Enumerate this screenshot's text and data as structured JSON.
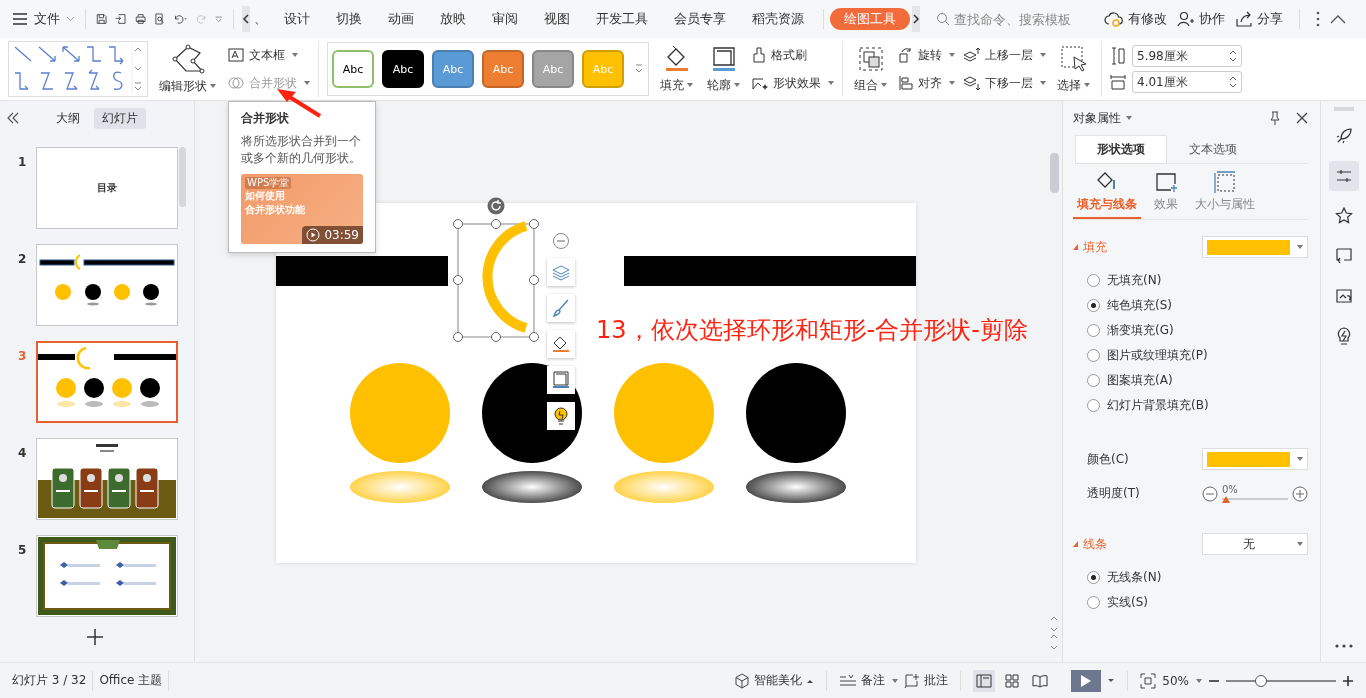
{
  "menu": {
    "file": "文件",
    "partial_tab": "、",
    "tabs": [
      {
        "label": "设计",
        "selected": false
      },
      {
        "label": "切换",
        "selected": false
      },
      {
        "label": "动画",
        "selected": false
      },
      {
        "label": "放映",
        "selected": false
      },
      {
        "label": "审阅",
        "selected": false
      },
      {
        "label": "视图",
        "selected": false
      },
      {
        "label": "开发工具",
        "selected": false
      },
      {
        "label": "会员专享",
        "selected": false
      },
      {
        "label": "稻壳资源",
        "selected": false
      }
    ],
    "context_tab": {
      "label": "绘图工具",
      "selected": true
    },
    "search": {
      "placeholder": "查找命令、搜索模板"
    },
    "actions": [
      "有修改",
      "协作",
      "分享"
    ]
  },
  "ribbon": {
    "edit_shape": "编辑形状",
    "textbox": "文本框",
    "merge_shape": {
      "label": "合并形状",
      "disabled": true
    },
    "styles": [
      {
        "label": "Abc",
        "color": "#ffffff"
      },
      {
        "label": "Abc",
        "color": "#000000"
      },
      {
        "label": "Abc",
        "color": "#5b9bd5"
      },
      {
        "label": "Abc",
        "color": "#ed7d31"
      },
      {
        "label": "Abc",
        "color": "#a5a5a5"
      },
      {
        "label": "Abc",
        "color": "#ffc000"
      }
    ],
    "fill": "填充",
    "outline": "轮廓",
    "format_painter": "格式刷",
    "shape_effects": "形状效果",
    "group": "组合",
    "rotate": "旋转",
    "align": "对齐",
    "bring_forward": "上移一层",
    "send_backward": "下移一层",
    "select": "选择",
    "height": "5.98厘米",
    "width": "4.01厘米"
  },
  "tooltip": {
    "title": "合并形状",
    "description": "将所选形状合并到一个或多个新的几何形状。",
    "video": {
      "brand": "WPS学堂",
      "title": [
        "如何使用",
        "合并形状功能"
      ],
      "duration": "03:59"
    }
  },
  "slides_panel": {
    "tabs": [
      {
        "label": "大纲",
        "selected": false
      },
      {
        "label": "幻灯片",
        "selected": true
      }
    ],
    "slides": [
      {
        "number": "1",
        "kind": "toc",
        "text": "目录",
        "selected": false
      },
      {
        "number": "2",
        "kind": "bars",
        "selected": false
      },
      {
        "number": "3",
        "kind": "current",
        "selected": true
      },
      {
        "number": "4",
        "kind": "cards",
        "selected": false
      },
      {
        "number": "5",
        "kind": "frame",
        "selected": false
      }
    ]
  },
  "slide": {
    "circles": [
      {
        "color": "#ffc000"
      },
      {
        "color": "#000000"
      },
      {
        "color": "#ffc000"
      },
      {
        "color": "#000000"
      }
    ],
    "annotation": "13，依次选择环形和矩形-合并形状-剪除"
  },
  "properties": {
    "title": "对象属性",
    "tabs": [
      {
        "label": "形状选项",
        "selected": true
      },
      {
        "label": "文本选项",
        "selected": false
      }
    ],
    "subtabs": [
      {
        "label": "填充与线条",
        "selected": true
      },
      {
        "label": "效果",
        "selected": false
      },
      {
        "label": "大小与属性",
        "selected": false
      }
    ],
    "fill": {
      "title": "填充",
      "color": "#ffc000",
      "options": [
        {
          "label": "无填充(N)",
          "selected": false
        },
        {
          "label": "纯色填充(S)",
          "selected": true
        },
        {
          "label": "渐变填充(G)",
          "selected": false
        },
        {
          "label": "图片或纹理填充(P)",
          "selected": false
        },
        {
          "label": "图案填充(A)",
          "selected": false
        },
        {
          "label": "幻灯片背景填充(B)",
          "selected": false
        }
      ],
      "color_label": "颜色(C)",
      "transparency_label": "透明度(T)",
      "transparency": {
        "level": 0,
        "reading": "0%"
      }
    },
    "line": {
      "title": "线条",
      "value": "无",
      "options": [
        {
          "label": "无线条(N)",
          "selected": true
        },
        {
          "label": "实线(S)",
          "selected": false
        }
      ]
    }
  },
  "side_tools": [
    {
      "selected": false
    },
    {
      "selected": true
    },
    {
      "selected": false
    },
    {
      "selected": false
    },
    {
      "selected": false
    },
    {
      "selected": false
    }
  ],
  "status_bar": {
    "slide_info": "幻灯片 3 / 32",
    "theme": "Office 主题",
    "beautify": "智能美化",
    "notes": "备注",
    "comments": "批注",
    "views": [
      {
        "selected": true
      },
      {
        "selected": false
      },
      {
        "selected": false
      }
    ],
    "zoom": "50%",
    "zoom_slider": {
      "level": 0.3
    }
  }
}
